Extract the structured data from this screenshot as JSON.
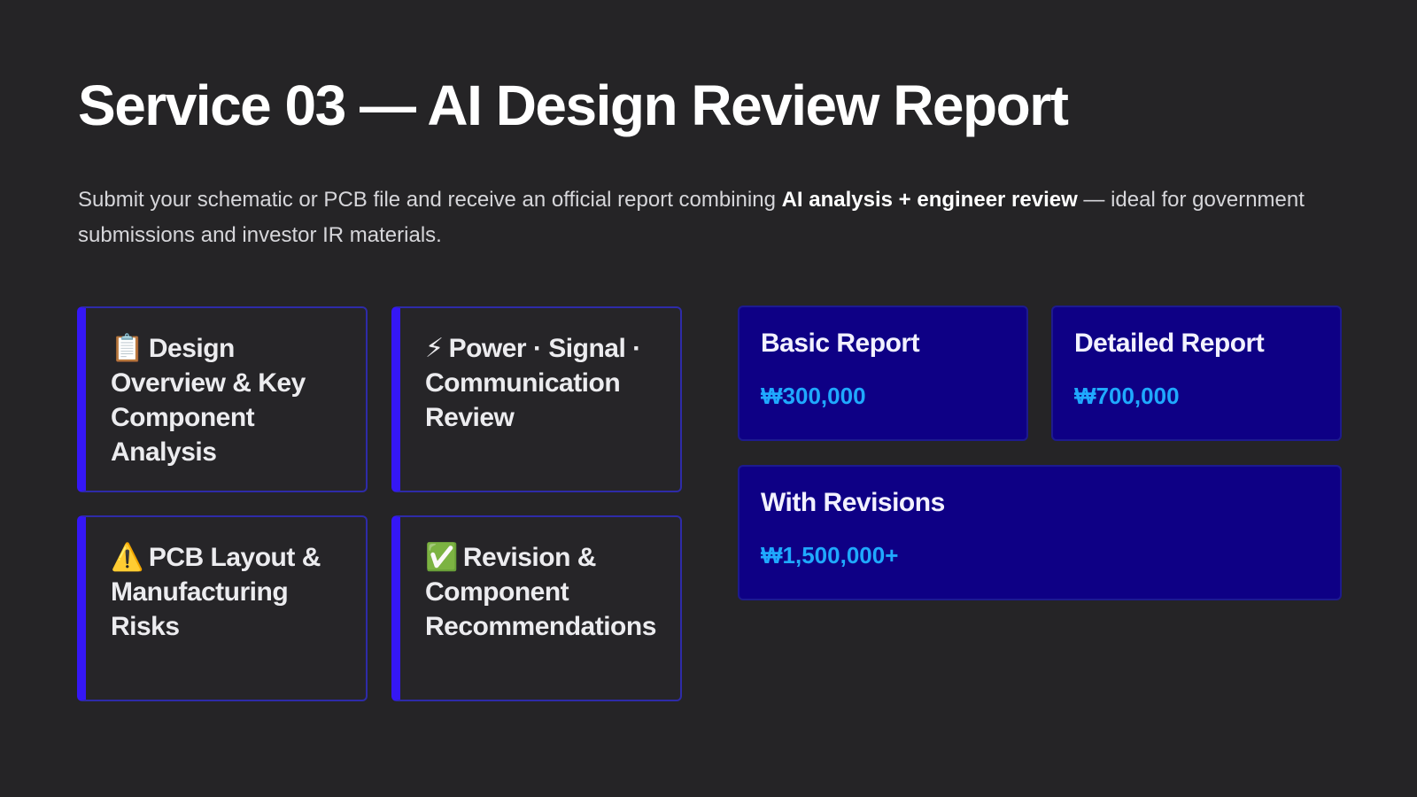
{
  "slide": {
    "title": "Service 03 — AI Design Review Report",
    "subtitle": {
      "pre": "Submit your schematic or PCB file and receive an official report combining ",
      "bold": "AI analysis + engineer review",
      "post": " — ideal for government submissions and investor IR materials."
    }
  },
  "features": [
    {
      "icon": "clipboard-icon",
      "glyph": "📋",
      "label": "Design Overview & Key Component Analysis"
    },
    {
      "icon": "lightning-icon",
      "glyph": "⚡",
      "label": "Power · Signal · Communication Review"
    },
    {
      "icon": "warning-icon",
      "glyph": "⚠️",
      "label": "PCB Layout & Manufacturing Risks"
    },
    {
      "icon": "check-icon",
      "glyph": "✅",
      "label": "Revision & Component Recommendations"
    }
  ],
  "pricing": [
    {
      "name": "Basic Report",
      "price": "₩300,000"
    },
    {
      "name": "Detailed Report",
      "price": "₩700,000"
    },
    {
      "name": "With Revisions",
      "price": "₩1,500,000+"
    }
  ],
  "colors": {
    "background": "#252426",
    "card_border_accent": "#3517f5",
    "price_card_bg": "#0e0085",
    "price_text": "#1fa9ff"
  }
}
